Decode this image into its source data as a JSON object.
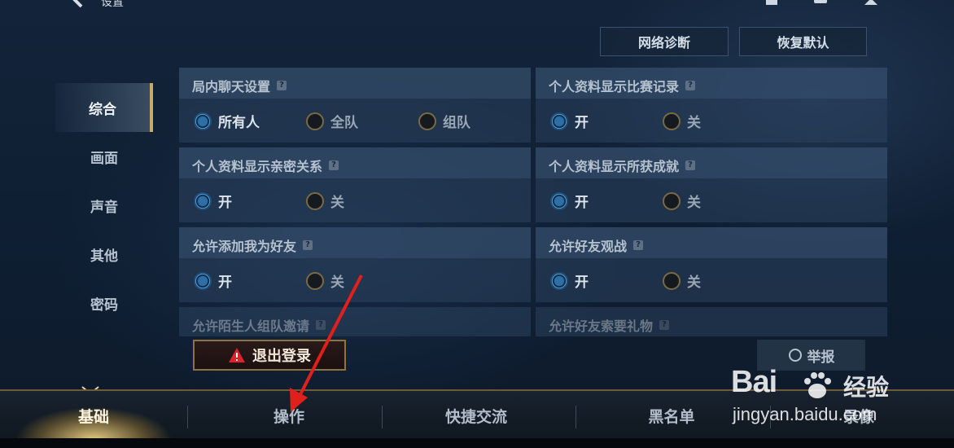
{
  "header": {
    "title": "设置",
    "diagnose_button": "网络诊断",
    "reset_button": "恢复默认"
  },
  "sidebar": {
    "items": [
      {
        "label": "综合",
        "active": true
      },
      {
        "label": "画面",
        "active": false
      },
      {
        "label": "声音",
        "active": false
      },
      {
        "label": "其他",
        "active": false
      },
      {
        "label": "密码",
        "active": false
      }
    ]
  },
  "settings": {
    "chat": {
      "title": "局内聊天设置",
      "options": [
        "所有人",
        "全队",
        "组队"
      ],
      "selected": "所有人"
    },
    "show_match": {
      "title": "个人资料显示比赛记录",
      "options": [
        "开",
        "关"
      ],
      "selected": "开"
    },
    "show_intimate": {
      "title": "个人资料显示亲密关系",
      "options": [
        "开",
        "关"
      ],
      "selected": "开"
    },
    "show_achieve": {
      "title": "个人资料显示所获成就",
      "options": [
        "开",
        "关"
      ],
      "selected": "开"
    },
    "allow_friend": {
      "title": "允许添加我为好友",
      "options": [
        "开",
        "关"
      ],
      "selected": "开"
    },
    "allow_watch": {
      "title": "允许好友观战",
      "options": [
        "开",
        "关"
      ],
      "selected": "开"
    },
    "allow_stranger": {
      "title": "允许陌生人组队邀请"
    },
    "allow_gift": {
      "title": "允许好友索要礼物"
    }
  },
  "actions": {
    "logout": "退出登录",
    "report": "举报"
  },
  "tabs": [
    {
      "label": "基础",
      "active": true
    },
    {
      "label": "操作",
      "active": false
    },
    {
      "label": "快捷交流",
      "active": false
    },
    {
      "label": "黑名单",
      "active": false
    },
    {
      "label": "录像",
      "active": false
    }
  ],
  "watermark": {
    "logo": "Bai",
    "logo_cn": "经验",
    "url": "jingyan.baidu.com"
  },
  "colors": {
    "accent_gold": "#c8a96a",
    "radio_on_blue": "#58a9e4",
    "annotation_red": "#e0201a"
  }
}
